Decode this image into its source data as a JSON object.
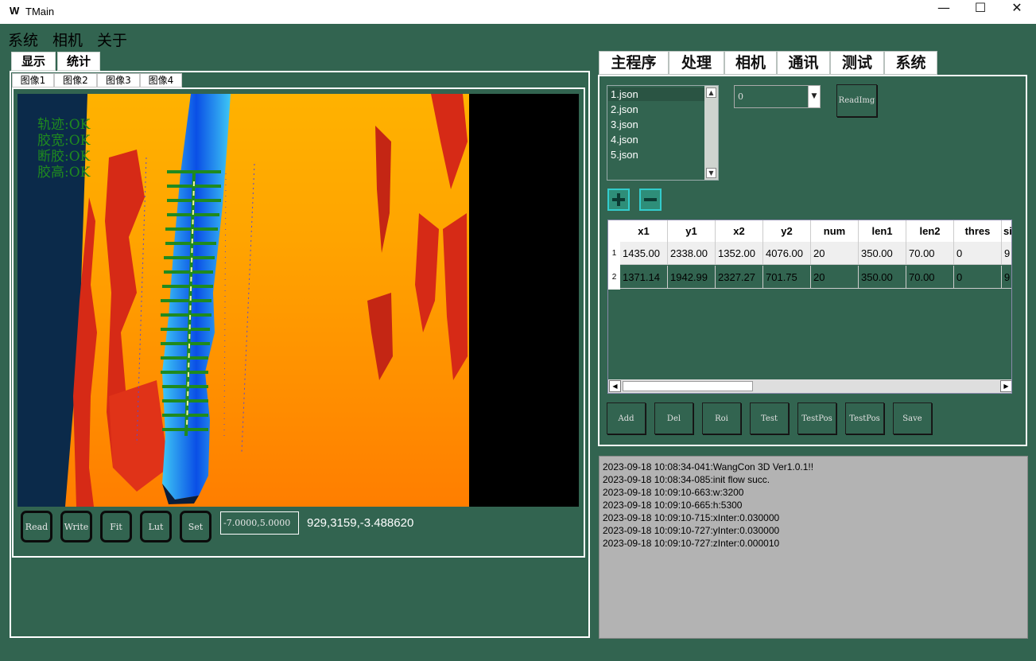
{
  "window": {
    "logo": "W",
    "title": "TMain",
    "minimize": "—",
    "maximize": "☐",
    "close": "✕"
  },
  "menu": [
    "系统",
    "相机",
    "关于"
  ],
  "left_tabs": [
    "显示",
    "统计"
  ],
  "image_tabs": [
    "图像1",
    "图像2",
    "图像3",
    "图像4"
  ],
  "overlay": [
    "轨迹:OK",
    "胶宽:OK",
    "断胶:OK",
    "胶高:OK"
  ],
  "image_buttons": [
    "Read",
    "Write",
    "Fit",
    "Lut",
    "Set"
  ],
  "range_value": "-7.0000,5.0000",
  "coord_readout": "929,3159,-3.488620",
  "right_tabs": [
    "主程序",
    "处理",
    "相机",
    "通讯",
    "测试",
    "系统"
  ],
  "json_files": [
    "1.json",
    "2.json",
    "3.json",
    "4.json",
    "5.json"
  ],
  "combo_value": "0",
  "readimg_label": "ReadImg",
  "table": {
    "headers": [
      "x1",
      "y1",
      "x2",
      "y2",
      "num",
      "len1",
      "len2",
      "thres",
      "si"
    ],
    "rows": [
      {
        "id": "1",
        "cells": [
          "1435.00",
          "2338.00",
          "1352.00",
          "4076.00",
          "20",
          "350.00",
          "70.00",
          "0",
          "9"
        ]
      },
      {
        "id": "2",
        "cells": [
          "1371.14",
          "1942.99",
          "2327.27",
          "701.75",
          "20",
          "350.00",
          "70.00",
          "0",
          "9"
        ]
      }
    ]
  },
  "action_buttons": [
    "Add",
    "Del",
    "Roi",
    "Test",
    "TestPos",
    "TestPos",
    "Save"
  ],
  "log": [
    "2023-09-18 10:08:34-041:WangCon 3D Ver1.0.1!!",
    "2023-09-18 10:08:34-085:init flow succ.",
    "2023-09-18 10:09:10-663:w:3200",
    "2023-09-18 10:09:10-665:h:5300",
    "2023-09-18 10:09:10-715:xInter:0.030000",
    "2023-09-18 10:09:10-727:yInter:0.030000",
    "2023-09-18 10:09:10-727:zInter:0.000010"
  ],
  "colors": {
    "background": "#326450",
    "bead": "#1e90ff",
    "track_lines": "#1f8a1f",
    "heatmap_low": "#d62a16",
    "heatmap_high": "#ffb000"
  }
}
